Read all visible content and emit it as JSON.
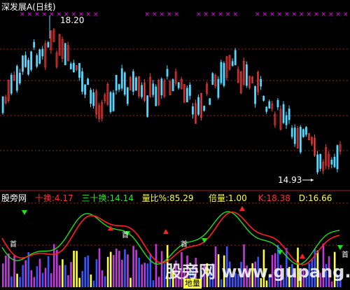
{
  "chart_title": "深发展A(日线)",
  "price_high_label": "18.20",
  "price_low_label": "14.93",
  "indicator": {
    "name": "股旁网",
    "items": [
      {
        "label": "十换:",
        "value": "4.17",
        "color": "#ff3030"
      },
      {
        "label": "三十换:",
        "value": "14.14",
        "color": "#30e030"
      },
      {
        "label": "量比%:",
        "value": "85.29",
        "color": "#ffff40"
      },
      {
        "label": "倍量:",
        "value": "1.00",
        "color": "#ffff40"
      },
      {
        "label": "K:",
        "value": "18.38",
        "color": "#ff3030"
      },
      {
        "label": "D:",
        "value": "16.66",
        "color": "#ffff40"
      }
    ],
    "marker_text": "首",
    "bottom_label": "地量"
  },
  "watermark": "股旁网 www.gupang.com",
  "colors": {
    "up": "#ff3c3c",
    "down": "#54d8ff",
    "x_marker": "#ff00ff",
    "k_line": "#ff2020",
    "d_line": "#20e020"
  },
  "chart_data": {
    "type": "candlestick",
    "panels": [
      "price",
      "indicator"
    ],
    "price_range_shown": [
      14.93,
      18.2
    ]
  }
}
